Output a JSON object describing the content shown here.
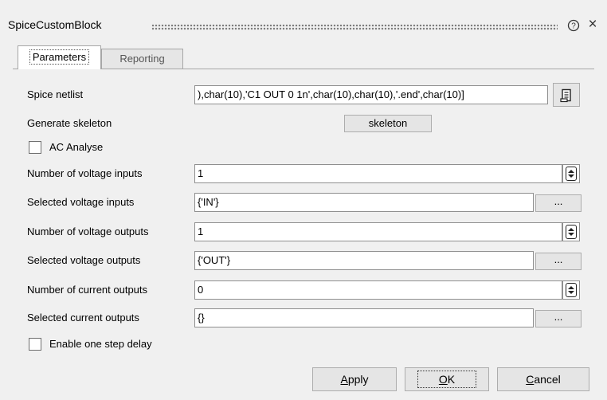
{
  "window": {
    "title": "SpiceCustomBlock",
    "help_glyph": "?",
    "close_glyph": "×"
  },
  "tabs": [
    {
      "label": "Parameters",
      "active": true
    },
    {
      "label": "Reporting",
      "active": false
    }
  ],
  "form": {
    "spice_netlist": {
      "label": "Spice netlist",
      "value": "),char(10),'C1 OUT 0 1n',char(10),char(10),'.end',char(10)]"
    },
    "generate_skeleton": {
      "label": "Generate skeleton",
      "button_label": "skeleton"
    },
    "ac_analyse": {
      "label": "AC Analyse",
      "checked": false
    },
    "num_voltage_inputs": {
      "label": "Number of voltage inputs",
      "value": "1"
    },
    "sel_voltage_inputs": {
      "label": "Selected voltage inputs",
      "value": "{'IN'}",
      "button": "..."
    },
    "num_voltage_outputs": {
      "label": "Number of voltage outputs",
      "value": "1"
    },
    "sel_voltage_outputs": {
      "label": "Selected voltage outputs",
      "value": "{'OUT'}",
      "button": "..."
    },
    "num_current_outputs": {
      "label": "Number of current outputs",
      "value": "0"
    },
    "sel_current_outputs": {
      "label": "Selected current outputs",
      "value": "{}",
      "button": "..."
    },
    "one_step_delay": {
      "label": "Enable one step delay",
      "checked": false
    }
  },
  "footer": {
    "apply": {
      "prefix": "",
      "mnemonic": "A",
      "rest": "pply"
    },
    "ok": {
      "prefix": "",
      "mnemonic": "O",
      "rest": "K"
    },
    "cancel": {
      "prefix": "",
      "mnemonic": "C",
      "rest": "ancel"
    }
  },
  "icons": {
    "edit": "edit-script-icon",
    "help": "help-icon",
    "close": "close-icon",
    "spin": "spin-updown-icon"
  }
}
